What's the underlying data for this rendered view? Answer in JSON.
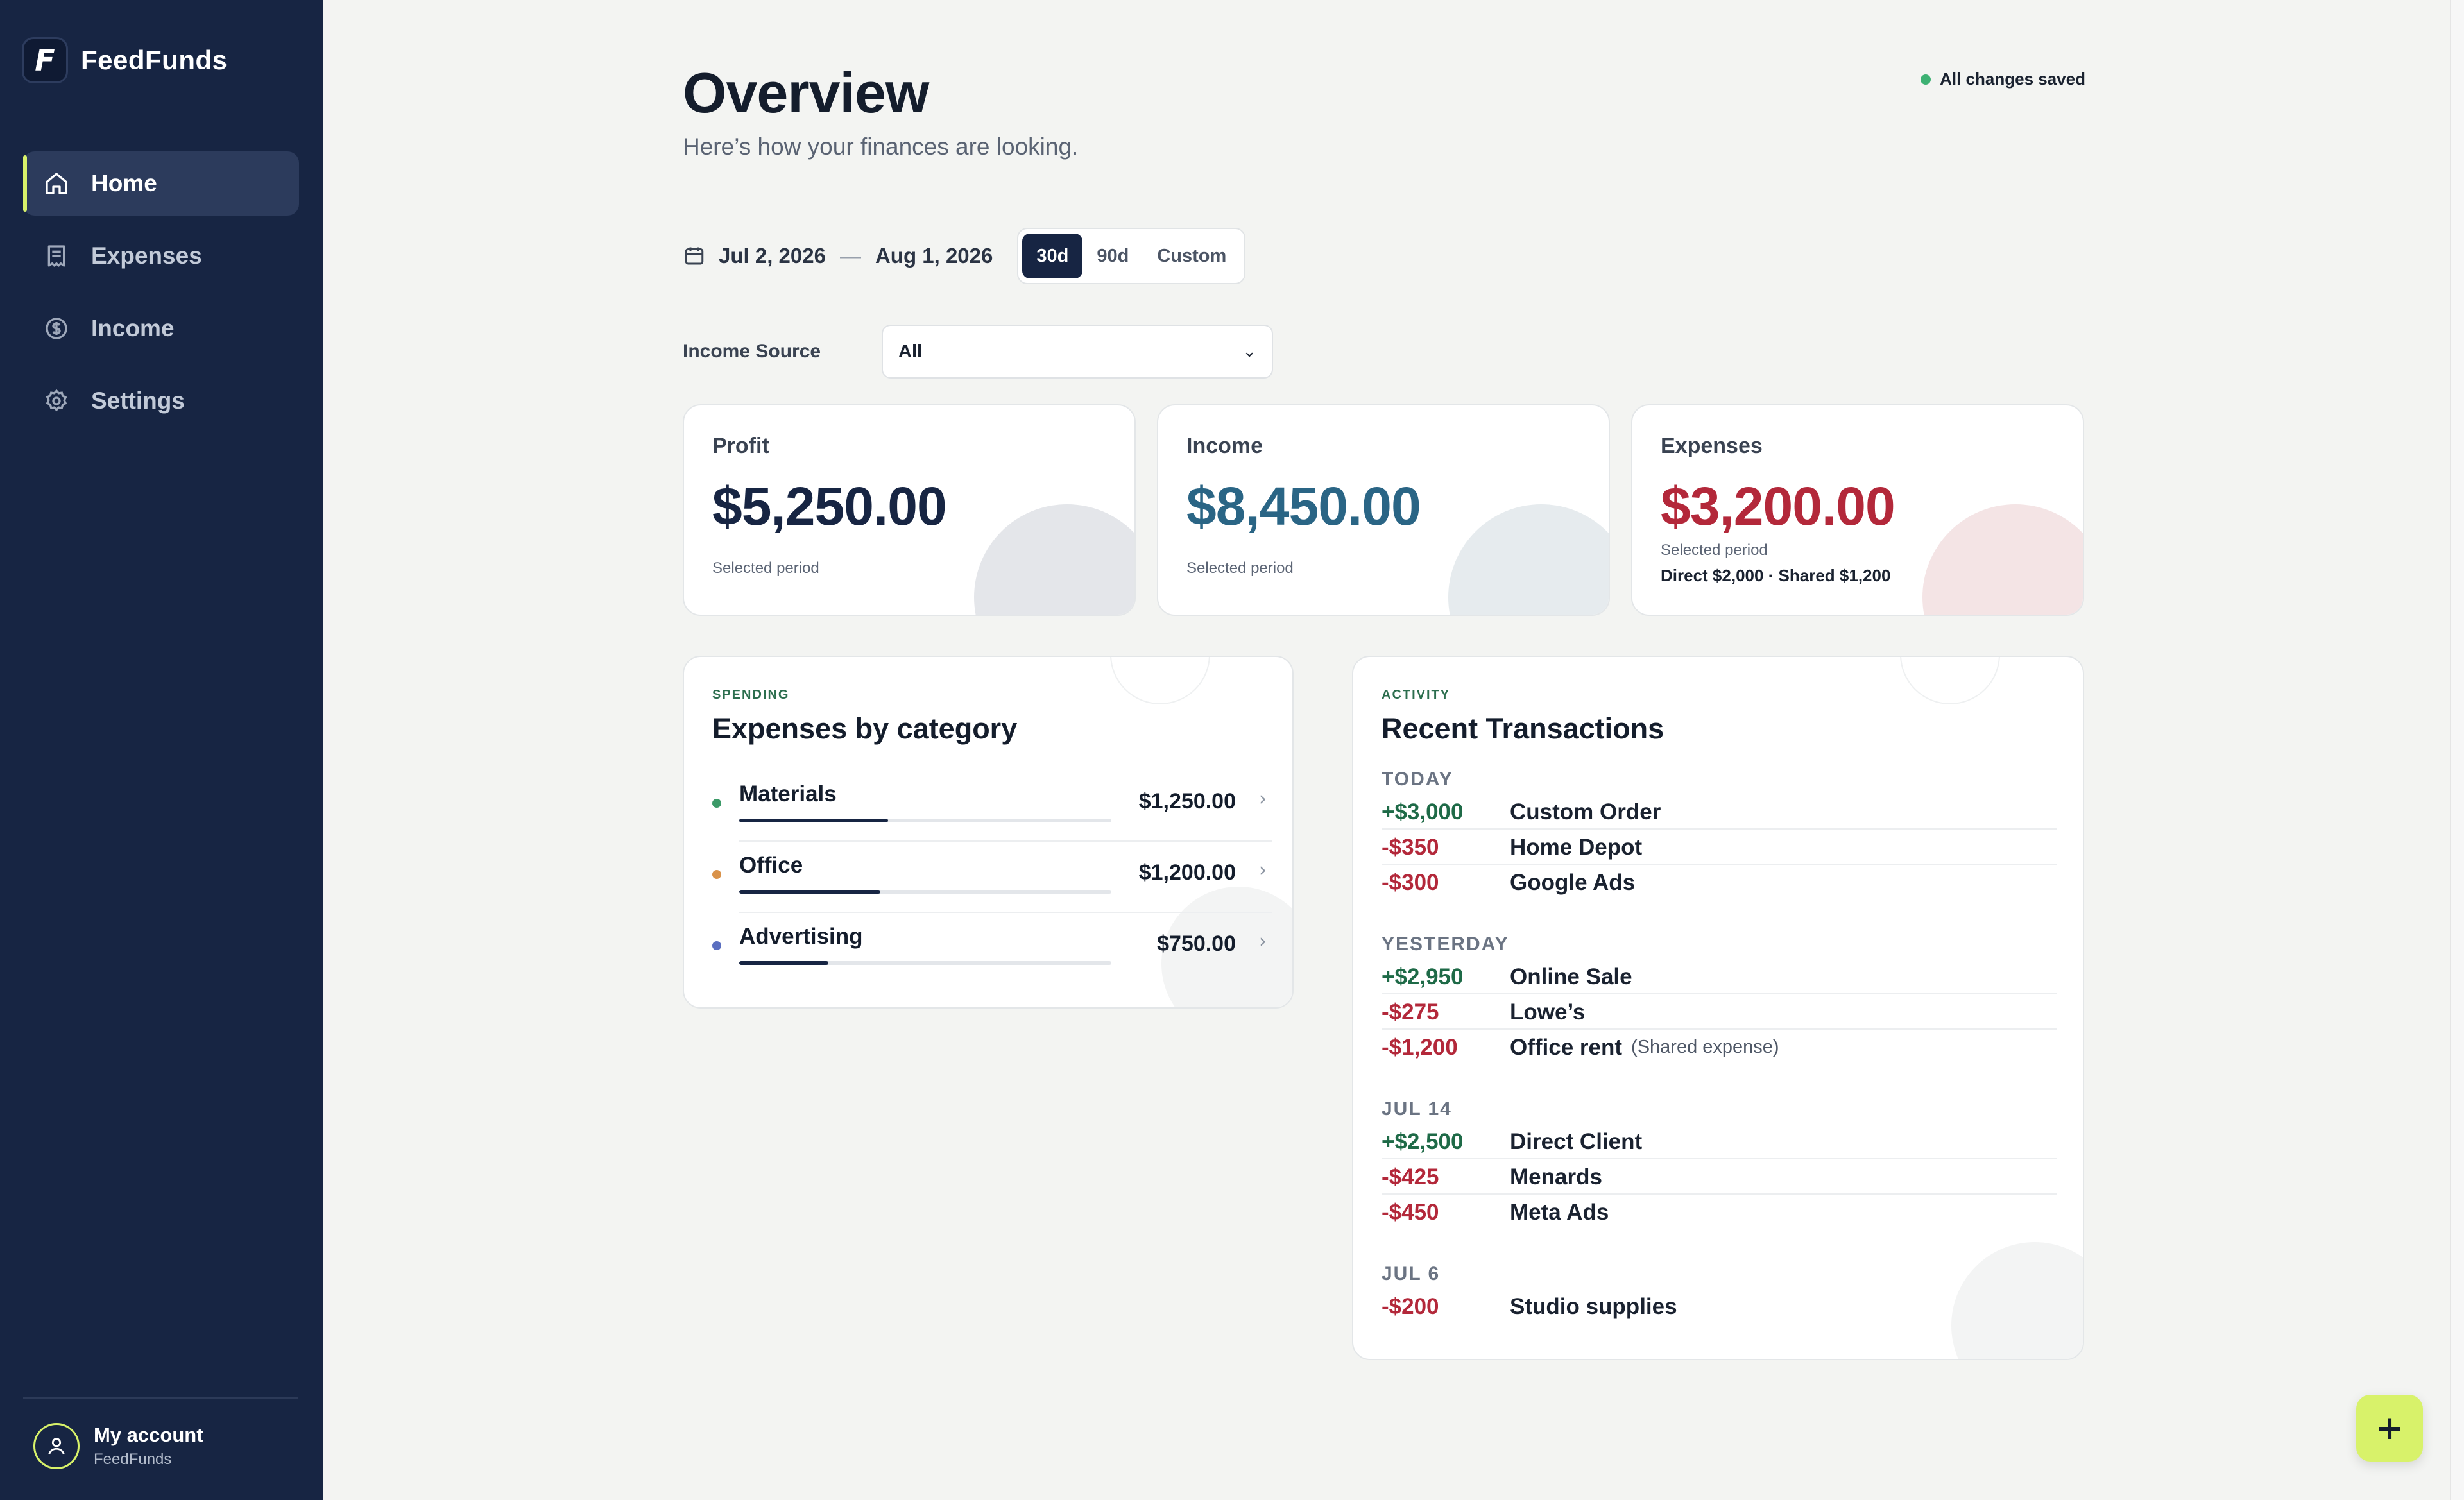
{
  "app": {
    "name": "FeedFunds",
    "logo_letter": "F"
  },
  "sidebar": {
    "items": [
      {
        "label": "Home",
        "icon": "home-icon",
        "active": true
      },
      {
        "label": "Expenses",
        "icon": "receipt-icon",
        "active": false
      },
      {
        "label": "Income",
        "icon": "dollar-circle-icon",
        "active": false
      },
      {
        "label": "Settings",
        "icon": "gear-icon",
        "active": false
      }
    ],
    "account": {
      "name": "My account",
      "org": "FeedFunds",
      "icon": "user-icon"
    }
  },
  "header": {
    "title": "Overview",
    "subtitle": "Here’s how your finances are looking.",
    "save_status": "All changes saved"
  },
  "date_range": {
    "start": "Jul 2, 2026",
    "separator": "—",
    "end": "Aug 1, 2026",
    "presets": [
      "30d",
      "90d",
      "Custom"
    ],
    "selected": "30d"
  },
  "filter": {
    "label": "Income Source",
    "value": "All",
    "chevron": "⌄"
  },
  "stats": {
    "profit": {
      "title": "Profit",
      "value": "$5,250.00",
      "note": "Selected period",
      "color": "#172543"
    },
    "income": {
      "title": "Income",
      "value": "$8,450.00",
      "note": "Selected period",
      "color": "#2a6585"
    },
    "expenses": {
      "title": "Expenses",
      "value": "$3,200.00",
      "note": "Selected period",
      "detail": "Direct $2,000 · Shared $1,200",
      "color": "#b3283a"
    }
  },
  "spending": {
    "eyebrow": "SPENDING",
    "title": "Expenses by category",
    "categories": [
      {
        "name": "Materials",
        "amount": "$1,250.00",
        "share": 0.4,
        "color": "#3c9a68"
      },
      {
        "name": "Office",
        "amount": "$1,200.00",
        "share": 0.38,
        "color": "#d9924a"
      },
      {
        "name": "Advertising",
        "amount": "$750.00",
        "share": 0.24,
        "color": "#5b6fc0"
      }
    ]
  },
  "activity": {
    "eyebrow": "ACTIVITY",
    "title": "Recent Transactions",
    "groups": [
      {
        "day": "TODAY",
        "items": [
          {
            "amount": "+$3,000",
            "name": "Custom Order",
            "type": "pos"
          },
          {
            "amount": "-$350",
            "name": "Home Depot",
            "type": "neg"
          },
          {
            "amount": "-$300",
            "name": "Google Ads",
            "type": "neg"
          }
        ]
      },
      {
        "day": "YESTERDAY",
        "items": [
          {
            "amount": "+$2,950",
            "name": "Online Sale",
            "type": "pos"
          },
          {
            "amount": "-$275",
            "name": "Lowe’s",
            "type": "neg"
          },
          {
            "amount": "-$1,200",
            "name": "Office rent",
            "note": "(Shared expense)",
            "type": "neg"
          }
        ]
      },
      {
        "day": "JUL 14",
        "items": [
          {
            "amount": "+$2,500",
            "name": "Direct Client",
            "type": "pos"
          },
          {
            "amount": "-$425",
            "name": "Menards",
            "type": "neg"
          },
          {
            "amount": "-$450",
            "name": "Meta Ads",
            "type": "neg"
          }
        ]
      },
      {
        "day": "JUL 6",
        "items": [
          {
            "amount": "-$200",
            "name": "Studio supplies",
            "type": "neg"
          }
        ]
      }
    ]
  },
  "fab": {
    "label": "+",
    "icon": "plus-icon"
  }
}
